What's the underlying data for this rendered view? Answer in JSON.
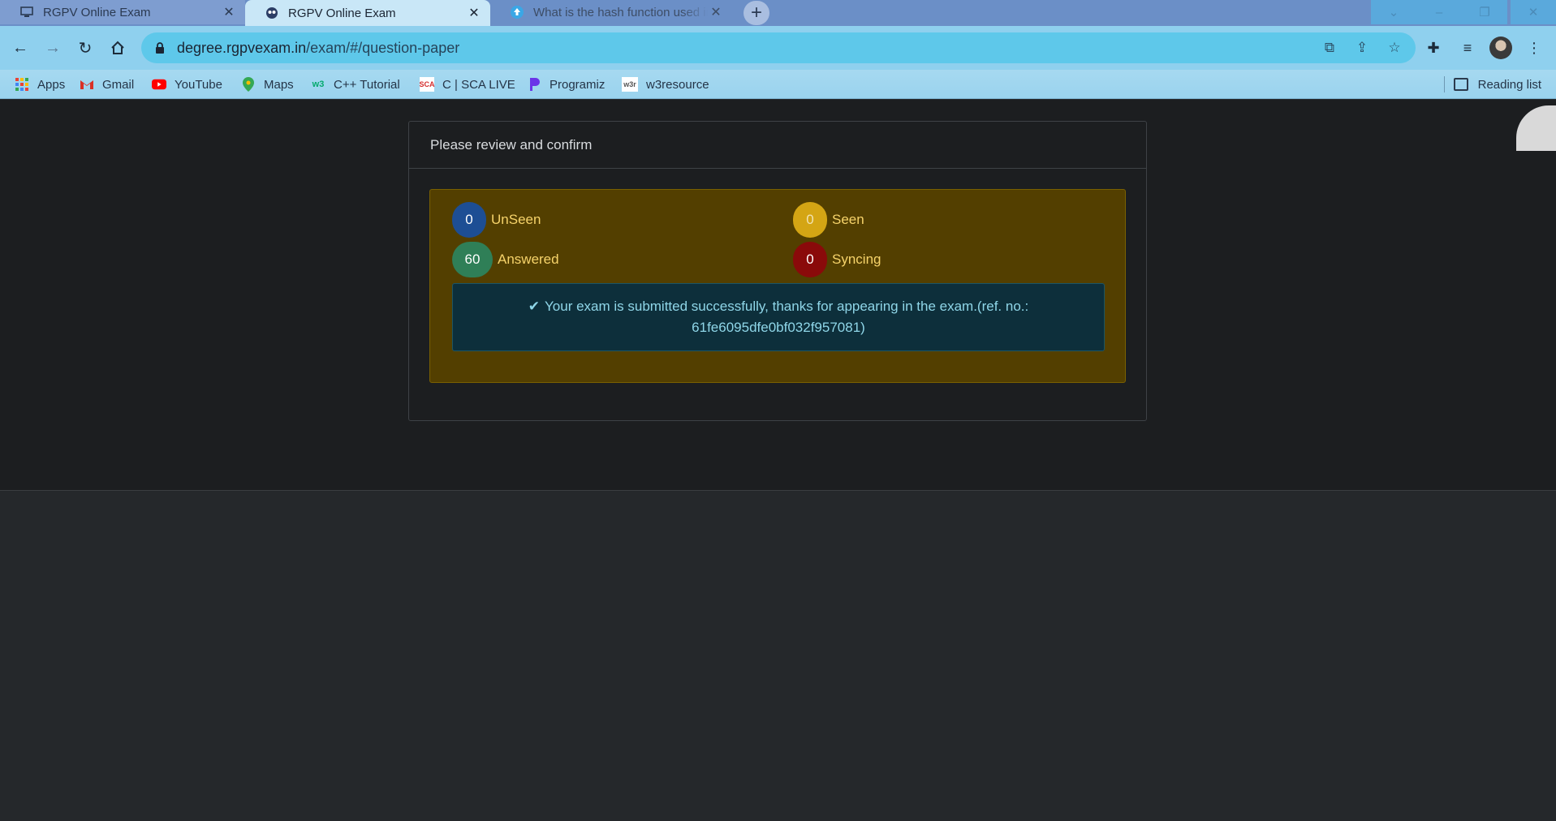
{
  "tabs": [
    {
      "title": "RGPV Online Exam",
      "close": "✕",
      "icon": "monitor-icon"
    },
    {
      "title": "RGPV Online Exam",
      "close": "✕",
      "icon": "owl-icon"
    },
    {
      "title": "What is the hash function used in",
      "close": "✕",
      "icon": "upload-arrow-icon"
    }
  ],
  "new_tab": "+",
  "window_controls": {
    "tab_search": "⌄",
    "minimize": "–",
    "restore": "❐",
    "close": "✕"
  },
  "address_bar": {
    "host": "degree.rgpvexam.in",
    "path": "/exam/#/question-paper"
  },
  "bookmarks": [
    {
      "label": "Apps",
      "icon": "apps-grid-icon"
    },
    {
      "label": "Gmail",
      "icon": "gmail-icon"
    },
    {
      "label": "YouTube",
      "icon": "youtube-icon"
    },
    {
      "label": "Maps",
      "icon": "maps-icon"
    },
    {
      "label": "C++ Tutorial",
      "icon": "w3schools-icon"
    },
    {
      "label": "C | SCA LIVE",
      "icon": "sca-icon"
    },
    {
      "label": "Programiz",
      "icon": "programiz-icon"
    },
    {
      "label": "w3resource",
      "icon": "w3resource-icon"
    }
  ],
  "reading_list": "Reading list",
  "card": {
    "header": "Please review and confirm",
    "stats": {
      "unseen": {
        "count": "0",
        "label": "UnSeen"
      },
      "seen": {
        "count": "0",
        "label": "Seen"
      },
      "answered": {
        "count": "60",
        "label": "Answered"
      },
      "syncing": {
        "count": "0",
        "label": "Syncing"
      }
    },
    "message": "Your exam is submitted successfully, thanks for appearing in the exam.(ref. no.: 61fe6095dfe0bf032f957081)"
  },
  "colors": {
    "unseen": "#1d4e94",
    "seen": "#d4a514",
    "answered": "#2f7f57",
    "syncing": "#8a0a0a",
    "panel": "#533f00",
    "alert": "#0d2f3b"
  }
}
